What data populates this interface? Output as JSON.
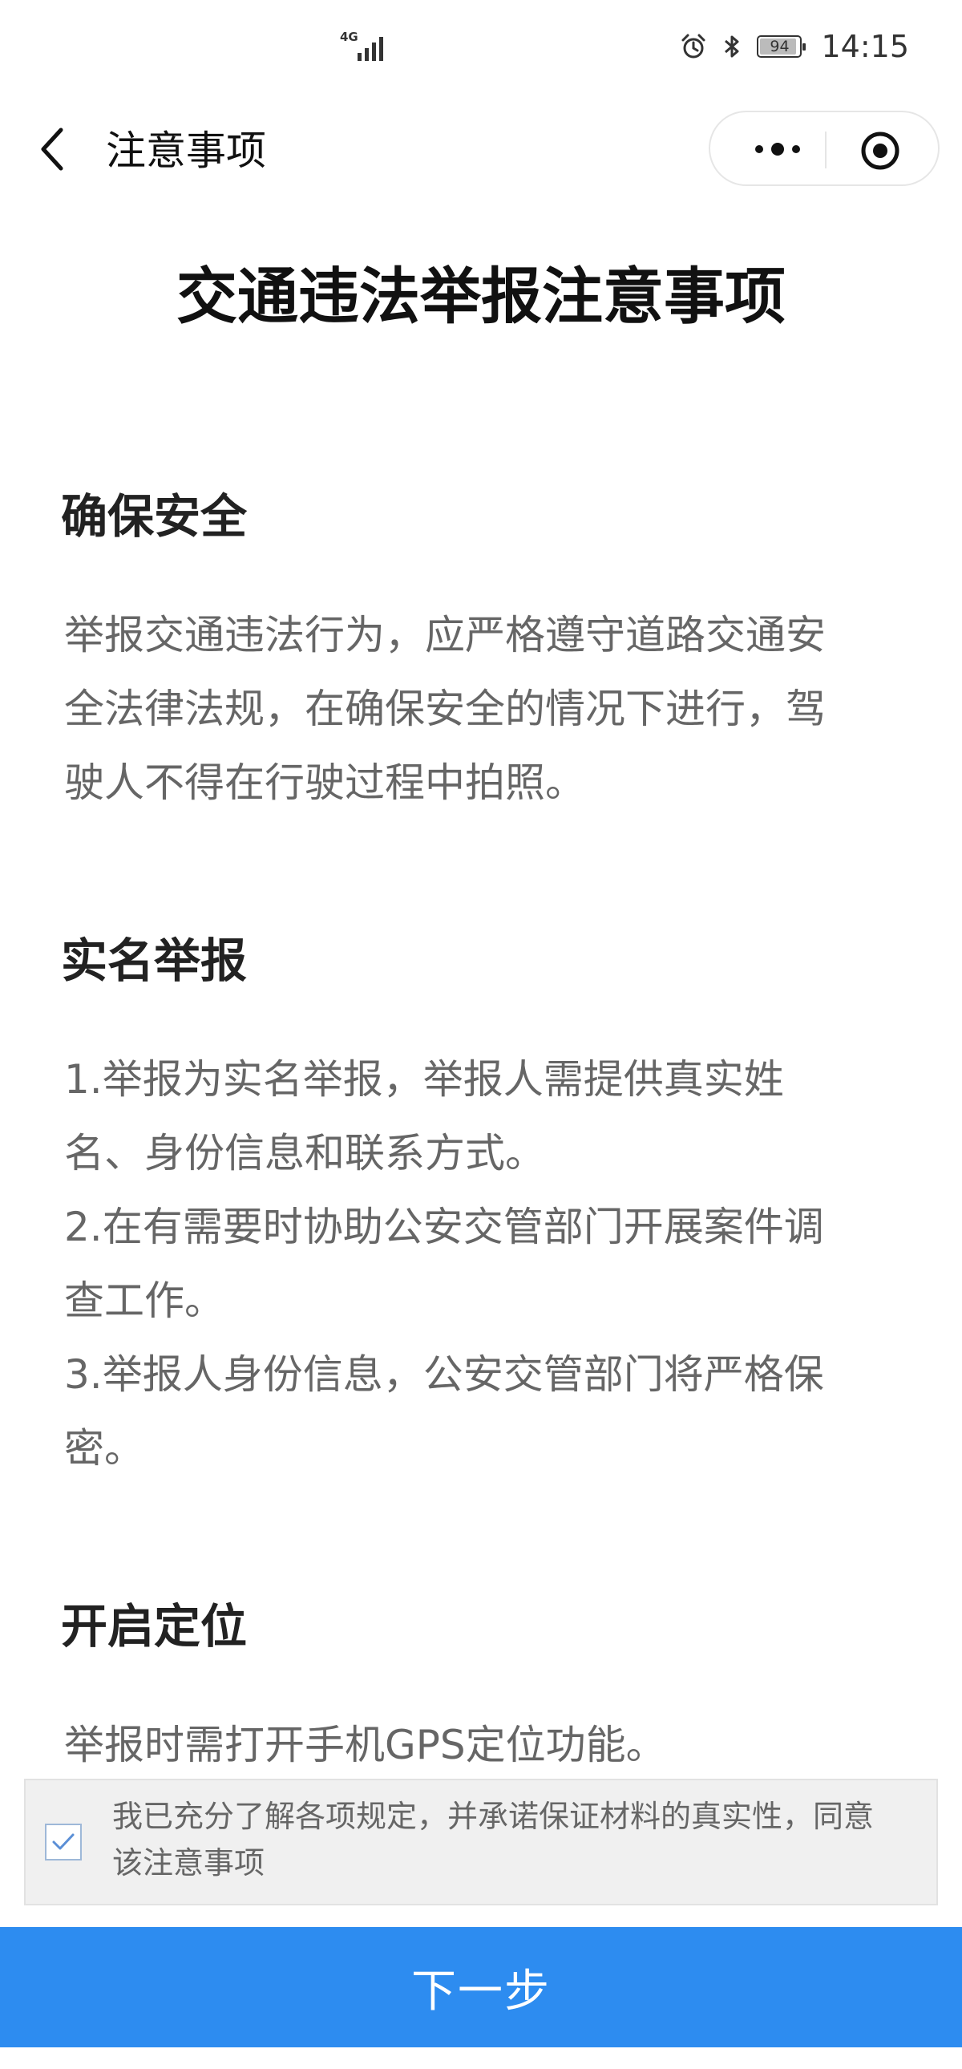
{
  "status_bar": {
    "network": "4G",
    "battery": "94",
    "battery_level": 0.94,
    "time": "14:15"
  },
  "navbar": {
    "title": "注意事项",
    "back_icon": "chevron-left-icon",
    "more_icon": "more-dots-icon",
    "close_icon": "target-circle-icon"
  },
  "page": {
    "heading": "交通违法举报注意事项"
  },
  "sections": [
    {
      "title": "确保安全",
      "lines": [
        "举报交通违法行为，应严格遵守道路交通安",
        "全法律法规，在确保安全的情况下进行，驾",
        "驶人不得在行驶过程中拍照。"
      ]
    },
    {
      "title": "实名举报",
      "lines": [
        "1.举报为实名举报，举报人需提供真实姓",
        "名、身份信息和联系方式。",
        "2.在有需要时协助公安交管部门开展案件调",
        "查工作。",
        "3.举报人身份信息，公安交管部门将严格保",
        "密。"
      ]
    },
    {
      "title": "开启定位",
      "lines": [
        "举报时需打开手机GPS定位功能。"
      ]
    }
  ],
  "consent": {
    "checked": true,
    "line1": "我已充分了解各项规定，并承诺保证材料的真实性，同意",
    "line2": "该注意事项"
  },
  "next_button": {
    "label": "下一步",
    "color": "#2d8cf0"
  }
}
